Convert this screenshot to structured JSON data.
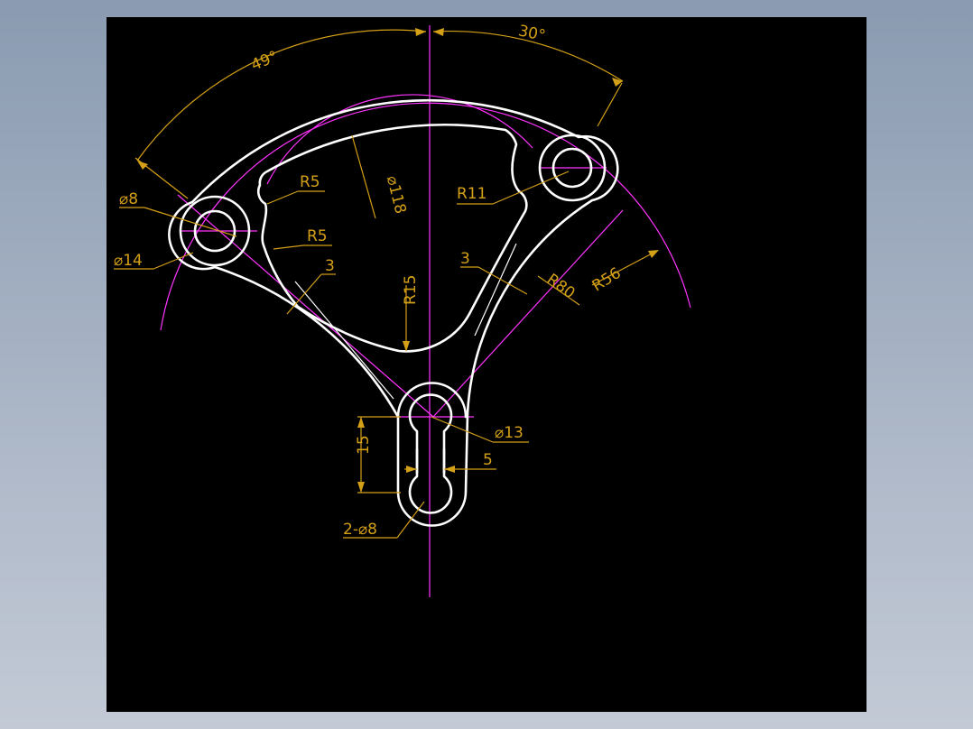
{
  "drawing": {
    "background": "#000000",
    "geometry_color": "#ffffff",
    "centerline_color": "#ff33ff",
    "dimension_color": "#d4a017",
    "dimensions": {
      "angle_left": "49°",
      "angle_right": "30°",
      "hole_small_left": "⌀8",
      "boss_left": "⌀14",
      "fillet_upper": "R5",
      "fillet_lower": "R5",
      "pitch_circle": "⌀118",
      "fillet_right": "R11",
      "wall_left": "3",
      "wall_right": "3",
      "fillet_bottom": "R15",
      "arc_outer": "R80",
      "arc_pitch": "R56",
      "boss_bottom": "⌀13",
      "slot_length": "15",
      "slot_width": "5",
      "slot_holes": "2-⌀8"
    }
  }
}
